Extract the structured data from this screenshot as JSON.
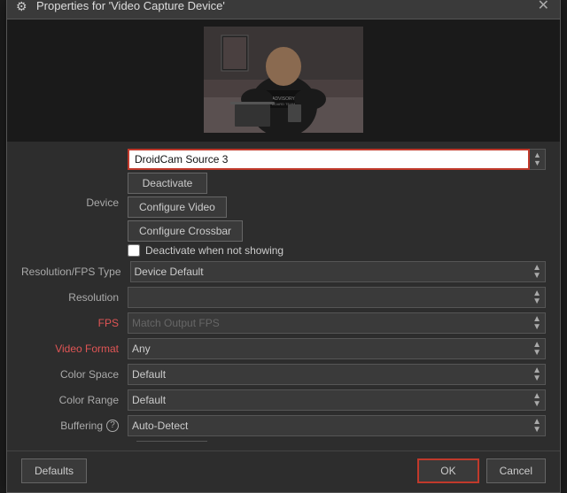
{
  "dialog": {
    "title": "Properties for 'Video Capture Device'",
    "title_icon": "⚙",
    "close_label": "✕"
  },
  "device": {
    "label": "Device",
    "value": "DroidCam Source 3",
    "deactivate_btn": "Deactivate",
    "configure_video_btn": "Configure Video",
    "configure_crossbar_btn": "Configure Crossbar",
    "deactivate_checkbox_label": "Deactivate when not showing",
    "deactivate_checked": false
  },
  "resolution_fps": {
    "label": "Resolution/FPS Type",
    "value": "Device Default"
  },
  "resolution": {
    "label": "Resolution",
    "value": ""
  },
  "fps": {
    "label": "FPS",
    "value": "Match Output FPS",
    "is_red": false
  },
  "video_format": {
    "label": "Video Format",
    "value": "Any",
    "is_red": true
  },
  "color_space": {
    "label": "Color Space",
    "value": "Default"
  },
  "color_range": {
    "label": "Color Range",
    "value": "Default"
  },
  "buffering": {
    "label": "Buffering",
    "help": "?",
    "value": "Auto-Detect"
  },
  "footer": {
    "defaults_btn": "Defaults",
    "ok_btn": "OK",
    "cancel_btn": "Cancel"
  }
}
